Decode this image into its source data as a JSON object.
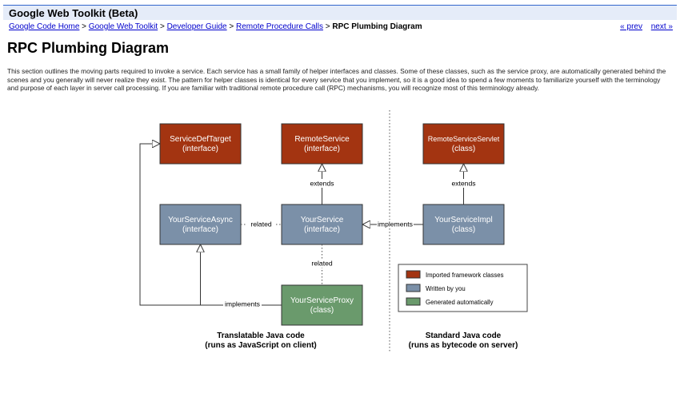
{
  "header": {
    "site_title": "Google Web Toolkit (Beta)"
  },
  "breadcrumb": {
    "items": [
      {
        "label": "Google Code Home"
      },
      {
        "label": "Google Web Toolkit"
      },
      {
        "label": "Developer Guide"
      },
      {
        "label": "Remote Procedure Calls"
      }
    ],
    "separator": ">",
    "current": "RPC Plumbing Diagram"
  },
  "pager": {
    "prev": "« prev",
    "next": "next »"
  },
  "page": {
    "title": "RPC Plumbing Diagram",
    "intro": "This section outlines the moving parts required to invoke a service. Each service has a small family of helper interfaces and classes. Some of these classes, such as the service proxy, are automatically generated behind the scenes and you generally will never realize they exist. The pattern for helper classes is identical for every service that you implement, so it is a good idea to spend a few moments to familiarize yourself with the terminology and purpose of each layer in server call processing. If you are familiar with traditional remote procedure call (RPC) mechanisms, you will recognize most of this terminology already."
  },
  "colors": {
    "framework": "#a33411",
    "written_by_you": "#7b90a8",
    "generated": "#6a9a6c",
    "header_bg": "#e5ecf9",
    "link": "#0000cc"
  },
  "diagram": {
    "boxes": {
      "service_def_target": {
        "line1": "ServiceDefTarget",
        "line2": "(interface)"
      },
      "remote_service": {
        "line1": "RemoteService",
        "line2": "(interface)"
      },
      "remote_service_servlet": {
        "line1": "RemoteServiceServlet",
        "line2": "(class)"
      },
      "your_service_async": {
        "line1": "YourServiceAsync",
        "line2": "(interface)"
      },
      "your_service": {
        "line1": "YourService",
        "line2": "(interface)"
      },
      "your_service_impl": {
        "line1": "YourServiceImpl",
        "line2": "(class)"
      },
      "your_service_proxy": {
        "line1": "YourServiceProxy",
        "line2": "(class)"
      }
    },
    "labels": {
      "extends_1": "extends",
      "extends_2": "extends",
      "related_1": "related",
      "related_2": "related",
      "implements_1": "implements",
      "implements_2": "implements"
    },
    "legend": {
      "framework": "Imported framework classes",
      "written": "Written by you",
      "generated": "Generated automatically"
    },
    "captions": {
      "left_line1": "Translatable Java code",
      "left_line2": "(runs as JavaScript on client)",
      "right_line1": "Standard Java code",
      "right_line2": "(runs as bytecode on server)"
    }
  }
}
